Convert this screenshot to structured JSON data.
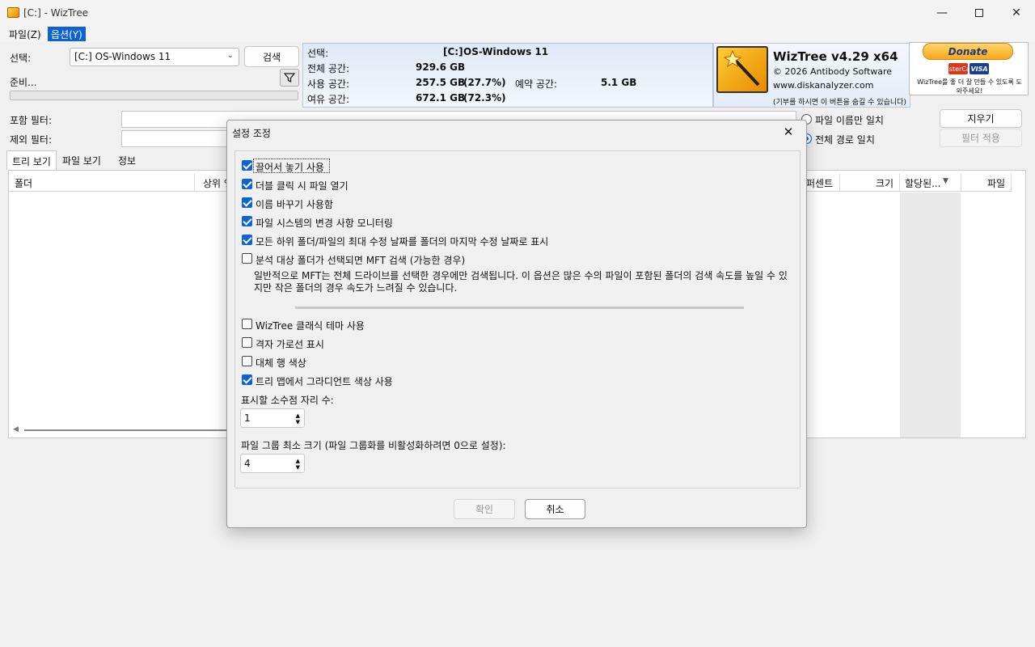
{
  "window": {
    "title": "[C:]  - WizTree"
  },
  "menu": {
    "file": "파일(Z)",
    "options": "옵션(Y)"
  },
  "left": {
    "select_label": "선택:",
    "drive_value": "[C:] OS-Windows 11",
    "scan_label": "검색",
    "status": "준비..."
  },
  "info": {
    "select_label": "선택:",
    "drive": "[C:]",
    "drive_name": "OS-Windows 11",
    "total_label": "전체 공간:",
    "total_value": "929.6 GB",
    "used_label": "사용 공간:",
    "used_value": "257.5 GB",
    "used_pct": "(27.7%)",
    "reserved_label": "예약 공간:",
    "reserved_value": "5.1 GB",
    "free_label": "여유 공간:",
    "free_value": "672.1 GB",
    "free_pct": "(72.3%)"
  },
  "brand": {
    "title": "WizTree v4.29 x64",
    "copyright": "© 2026 Antibody Software",
    "site": "www.diskanalyzer.com",
    "note": "(기부를 하시면 이 버튼을 숨길 수 있습니다)"
  },
  "donate": {
    "label": "Donate",
    "card1": "MasterCard",
    "card2": "VISA",
    "text1": "WizTree를 좋 더 잘 만들 수 있도록 도",
    "text2": "와주세요!"
  },
  "filters": {
    "include_label": "포함 필터:",
    "exclude_label": "제외 필터:",
    "name_only": "파일 이름만 일치",
    "full_path": "전체 경로 일치",
    "clear": "지우기",
    "apply": "필터 적용"
  },
  "tabs": {
    "tree": "트리 보기",
    "file": "파일 보기",
    "info": "정보"
  },
  "columns": {
    "folder": "폴더",
    "parent": "상위 %",
    "percent": "퍼센트",
    "size": "크기",
    "allocated": "할당된...",
    "files": "파일"
  },
  "dialog": {
    "title": "설정 조정",
    "options": [
      {
        "label": "끌어서 놓기 사용",
        "checked": true
      },
      {
        "label": "더블 클릭 시 파일 열기",
        "checked": true
      },
      {
        "label": "이름 바꾸기 사용함",
        "checked": true
      },
      {
        "label": "파일 시스템의 변경 사항 모니터링",
        "checked": true
      },
      {
        "label": "모든 하위 폴더/파일의 최대 수정 날짜를 폴더의 마지막 수정 날짜로 표시",
        "checked": true
      },
      {
        "label": "분석 대상 폴더가 선택되면 MFT 검색 (가능한 경우)",
        "checked": false
      }
    ],
    "mft_desc_1": "일반적으로 MFT는 전체 드라이브를 선택한 경우에만 검색됩니다. 이 옵션은 많은 수의 파일이 포함된 폴더의 검색 속도를 높일",
    "mft_desc_2": "수 있지만 작은 폴더의 경우 속도가 느려질 수 있습니다.",
    "options2": [
      {
        "label": "WizTree 클래식 테마 사용",
        "checked": false
      },
      {
        "label": "격자 가로선 표시",
        "checked": false
      },
      {
        "label": "대체 행 색상",
        "checked": false
      },
      {
        "label": "트리 맵에서 그라디언트 색상 사용",
        "checked": true
      }
    ],
    "decimals_label": "표시할 소수점 자리 수:",
    "decimals_value": "1",
    "group_label": "파일 그룹 최소 크기 (파일 그룹화를 비활성화하려면 0으로 설정):",
    "group_value": "4",
    "ok": "확인",
    "cancel": "취소"
  }
}
